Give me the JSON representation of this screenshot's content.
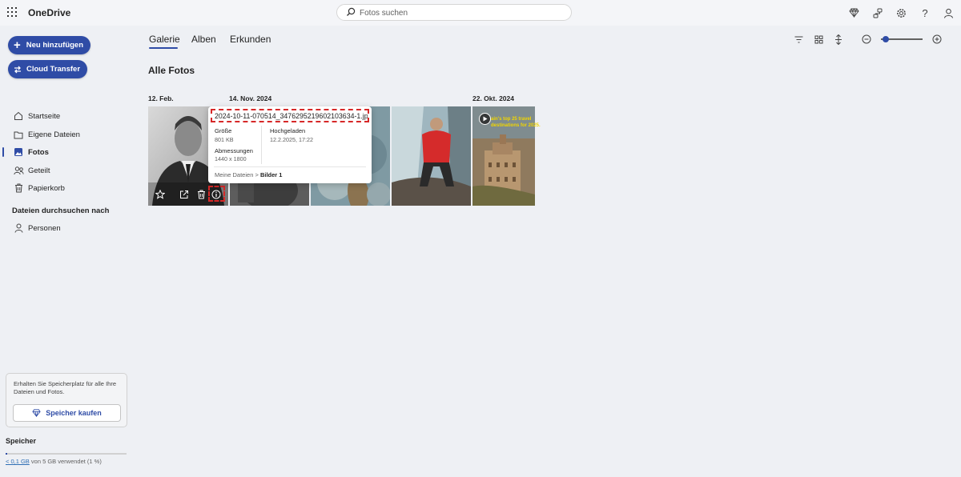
{
  "app": {
    "title": "OneDrive",
    "search_placeholder": "Fotos suchen",
    "header_icons": [
      "premium-diamond-icon",
      "share-link-icon",
      "settings-gear-icon",
      "help-icon",
      "account-icon"
    ]
  },
  "sidebar": {
    "add_button": "Neu hinzufügen",
    "transfer_button": "Cloud Transfer",
    "items": [
      {
        "label": "Startseite",
        "icon": "home-icon"
      },
      {
        "label": "Eigene Dateien",
        "icon": "folder-icon"
      },
      {
        "label": "Fotos",
        "icon": "photos-icon",
        "active": true
      },
      {
        "label": "Geteilt",
        "icon": "people-icon"
      },
      {
        "label": "Papierkorb",
        "icon": "trash-icon"
      }
    ],
    "browse_heading": "Dateien durchsuchen nach",
    "browse_items": [
      {
        "label": "Personen",
        "icon": "person-icon"
      }
    ],
    "promo": {
      "text": "Erhalten Sie Speicherplatz für alle Ihre Dateien und Fotos.",
      "button": "Speicher kaufen"
    },
    "storage": {
      "title": "Speicher",
      "used_link": "< 0,1 GB",
      "used_text": " von 5 GB verwendet (1 %)",
      "used_fraction": 0.01
    }
  },
  "main": {
    "tabs": [
      {
        "label": "Galerie",
        "active": true
      },
      {
        "label": "Alben"
      },
      {
        "label": "Erkunden"
      }
    ],
    "page_title": "Alle Fotos",
    "date_groups": [
      "12. Feb.",
      "14. Nov. 2024",
      "22. Okt. 2024"
    ],
    "photo_actions": [
      "favorite-star-icon",
      "share-icon",
      "delete-trash-icon",
      "info-icon"
    ],
    "toolbar_icons": [
      "filter-icon",
      "view-layout-icon",
      "sort-icon",
      "zoom-out-icon",
      "zoom-in-icon"
    ],
    "zoom_level": 0.05
  },
  "info_popup": {
    "filename": "2024-10-11-070514_3476295219602103634-1.jpg",
    "size_label": "Größe",
    "size_value": "801 KB",
    "uploaded_label": "Hochgeladen",
    "uploaded_value": "12.2.2025, 17:22",
    "dimensions_label": "Abmessungen",
    "dimensions_value": "1440 x 1800",
    "path_root": "Meine Dateien",
    "path_sep": ">",
    "path_folder": "Bilder 1"
  },
  "video_tile": {
    "text_line1": "ain's top 25 travel",
    "text_line2": "destinations for 2025."
  },
  "colors": {
    "accent": "#2f4ca6",
    "highlight": "#d62828",
    "background": "#eef0f4"
  }
}
